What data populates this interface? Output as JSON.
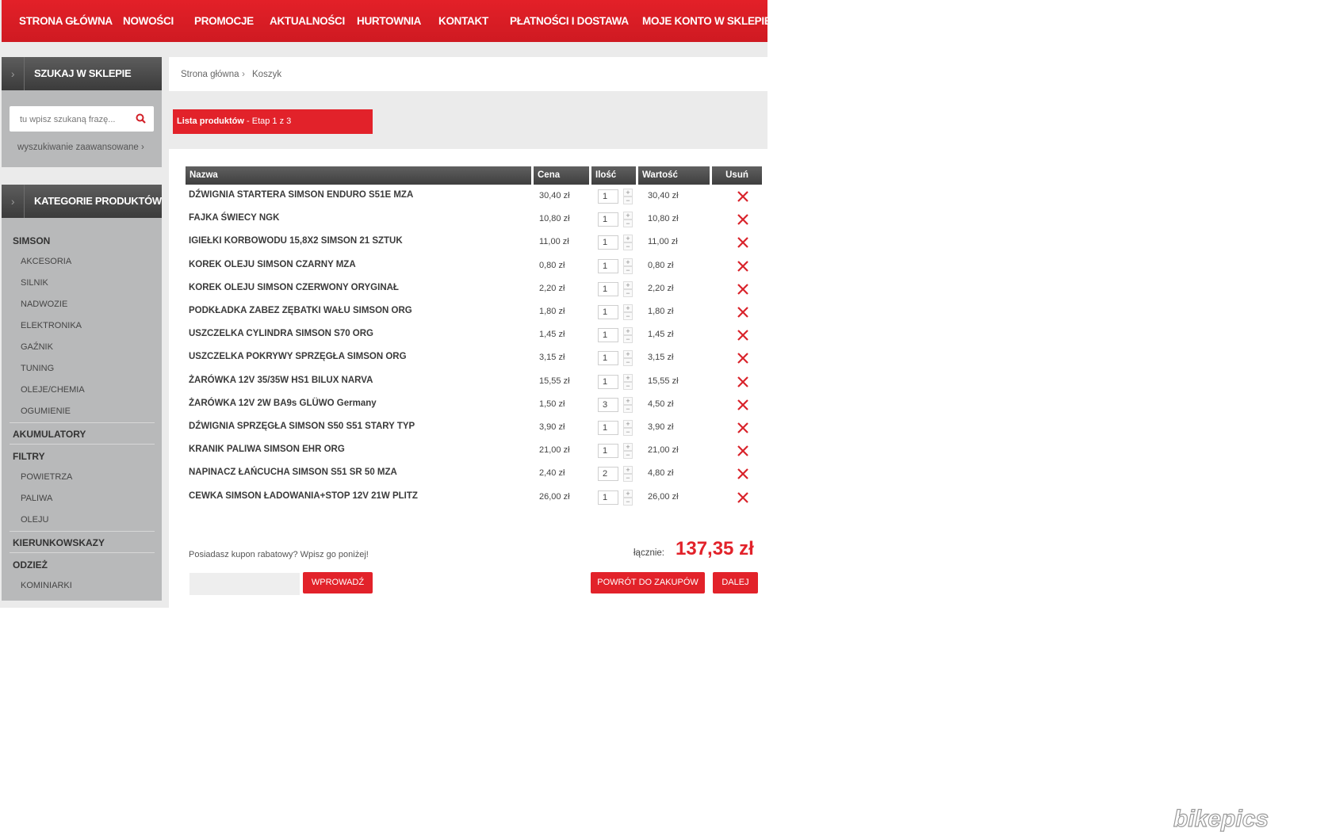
{
  "nav": {
    "items": [
      "STRONA GŁÓWNA",
      "NOWOŚCI",
      "PROMOCJE",
      "AKTUALNOŚCI",
      "HURTOWNIA",
      "KONTAKT",
      "PŁATNOŚCI I DOSTAWA",
      "MOJE KONTO W SKLEPIE"
    ]
  },
  "sidebar": {
    "search_title": "SZUKAJ W SKLEPIE",
    "search_placeholder": "tu wpisz szukaną frazę...",
    "advanced_link": "wyszukiwanie zaawansowane ›",
    "categories_title": "KATEGORIE PRODUKTÓW",
    "categories": [
      {
        "main": "SIMSON",
        "subs": [
          "AKCESORIA",
          "SILNIK",
          "NADWOZIE",
          "ELEKTRONIKA",
          "GAŹNIK",
          "TUNING",
          "OLEJE/CHEMIA",
          "OGUMIENIE"
        ]
      },
      {
        "main": "AKUMULATORY",
        "subs": []
      },
      {
        "main": "FILTRY",
        "subs": [
          "POWIETRZA",
          "PALIWA",
          "OLEJU"
        ]
      },
      {
        "main": "KIERUNKOWSKAZY",
        "subs": []
      },
      {
        "main": "ODZIEŻ",
        "subs": [
          "KOMINIARKI"
        ]
      }
    ]
  },
  "breadcrumb": {
    "home": "Strona główna",
    "sep": "›",
    "current": "Koszyk"
  },
  "step": {
    "title": "Lista produktów",
    "subtitle": " - Etap 1 z 3"
  },
  "table": {
    "headers": {
      "name": "Nazwa",
      "price": "Cena",
      "qty": "Ilość",
      "total": "Wartość",
      "remove": "Usuń"
    },
    "rows": [
      {
        "name": "DŹWIGNIA STARTERA SIMSON ENDURO S51E MZA",
        "price": "30,40 zł",
        "qty": "1",
        "total": "30,40 zł"
      },
      {
        "name": "FAJKA ŚWIECY NGK",
        "price": "10,80 zł",
        "qty": "1",
        "total": "10,80 zł"
      },
      {
        "name": "IGIEŁKI KORBOWODU 15,8X2 SIMSON 21 SZTUK",
        "price": "11,00 zł",
        "qty": "1",
        "total": "11,00 zł"
      },
      {
        "name": "KOREK OLEJU SIMSON CZARNY MZA",
        "price": "0,80 zł",
        "qty": "1",
        "total": "0,80 zł"
      },
      {
        "name": "KOREK OLEJU SIMSON CZERWONY ORYGINAŁ",
        "price": "2,20 zł",
        "qty": "1",
        "total": "2,20 zł"
      },
      {
        "name": "PODKŁADKA ZABEZ ZĘBATKI WAŁU SIMSON ORG",
        "price": "1,80 zł",
        "qty": "1",
        "total": "1,80 zł"
      },
      {
        "name": "USZCZELKA CYLINDRA SIMSON S70 ORG",
        "price": "1,45 zł",
        "qty": "1",
        "total": "1,45 zł"
      },
      {
        "name": "USZCZELKA POKRYWY SPRZĘGŁA SIMSON ORG",
        "price": "3,15 zł",
        "qty": "1",
        "total": "3,15 zł"
      },
      {
        "name": "ŻARÓWKA 12V 35/35W HS1 BILUX NARVA",
        "price": "15,55 zł",
        "qty": "1",
        "total": "15,55 zł"
      },
      {
        "name": "ŻARÓWKA 12V 2W BA9s GLÜWO Germany",
        "price": "1,50 zł",
        "qty": "3",
        "total": "4,50 zł"
      },
      {
        "name": "DŹWIGNIA SPRZĘGŁA SIMSON S50 S51 STARY TYP",
        "price": "3,90 zł",
        "qty": "1",
        "total": "3,90 zł"
      },
      {
        "name": "KRANIK PALIWA SIMSON EHR ORG",
        "price": "21,00 zł",
        "qty": "1",
        "total": "21,00 zł"
      },
      {
        "name": "NAPINACZ ŁAŃCUCHA SIMSON S51 SR 50 MZA",
        "price": "2,40 zł",
        "qty": "2",
        "total": "4,80 zł"
      },
      {
        "name": "CEWKA SIMSON ŁADOWANIA+STOP 12V 21W PLITZ",
        "price": "26,00 zł",
        "qty": "1",
        "total": "26,00 zł"
      }
    ],
    "qty_plus": "+",
    "qty_minus": "−"
  },
  "coupon": {
    "text": "Posiadasz kupon rabatowy? Wpisz go poniżej!",
    "button": "WPROWADŹ"
  },
  "summary": {
    "label": "łącznie:",
    "value": "137,35 zł"
  },
  "actions": {
    "back": "POWRÓT DO ZAKUPÓW",
    "next": "DALEJ"
  },
  "watermark": "bikepics",
  "colors": {
    "accent": "#e2222a",
    "header_dark": "#4a4a4a",
    "sidebar_bg": "#b8b9ba"
  }
}
